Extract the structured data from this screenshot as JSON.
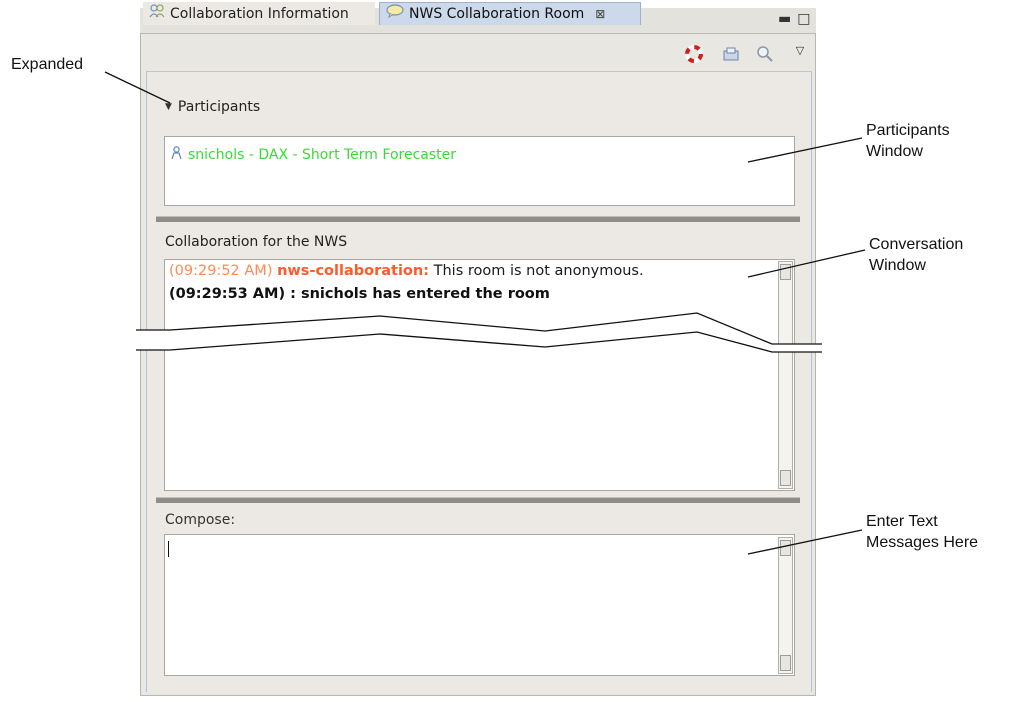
{
  "tabs": [
    {
      "label": "Collaboration Information",
      "active": false,
      "icon": "collaboration-icon"
    },
    {
      "label": "NWS Collaboration Room",
      "active": true,
      "icon": "chat-room-icon",
      "close_icon": "close-icon"
    }
  ],
  "window_controls": [
    "minimize-icon",
    "maximize-icon"
  ],
  "toolbar_icons": [
    "lifesaver-icon",
    "send-icon",
    "search-icon",
    "view-menu-icon"
  ],
  "participants": {
    "header": "Participants",
    "expand_icon": "triangle-down-icon",
    "items": [
      {
        "name": "snichols - DAX - Short Term Forecaster",
        "icon": "user-icon",
        "color": "#3ad93a"
      }
    ]
  },
  "conversation": {
    "title": "Collaboration for the NWS",
    "messages": [
      {
        "timestamp": "(09:29:52 AM)",
        "sender": "nws-collaboration:",
        "text": " This room is not anonymous."
      },
      {
        "text": "(09:29:53 AM) : snichols has entered the room"
      }
    ]
  },
  "compose": {
    "label": "Compose:",
    "value": ""
  },
  "callouts": {
    "expanded": "Expanded",
    "participants_window": [
      "Participants",
      "Window"
    ],
    "conversation_window": [
      "Conversation",
      "Window"
    ],
    "enter_text": [
      "Enter Text",
      "Messages Here"
    ]
  },
  "colors": {
    "active_tab": "#cbd9ea",
    "participant_text": "#3ad93a",
    "timestamp_orange": "#ff8a55",
    "sender_orange": "#ff5a2a"
  }
}
